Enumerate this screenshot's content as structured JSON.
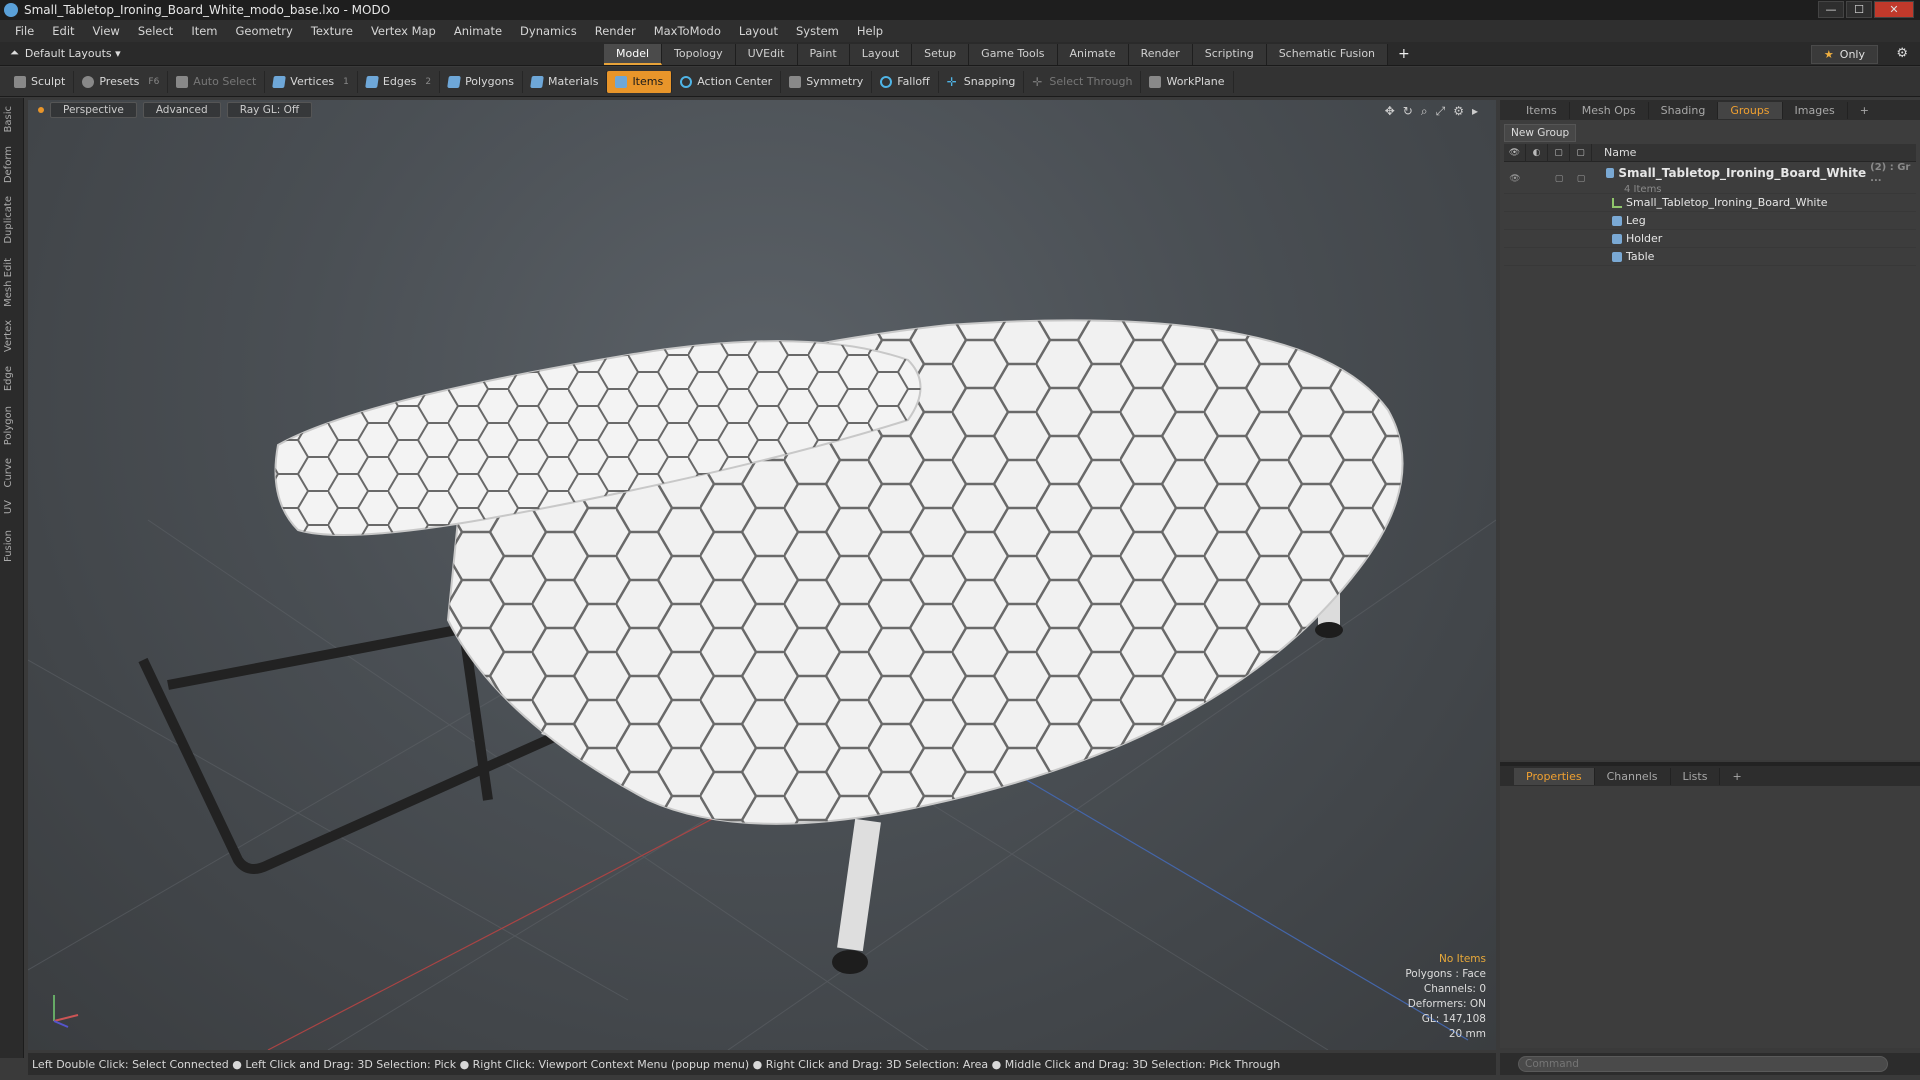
{
  "window": {
    "title": "Small_Tabletop_Ironing_Board_White_modo_base.lxo - MODO"
  },
  "menu": [
    "File",
    "Edit",
    "View",
    "Select",
    "Item",
    "Geometry",
    "Texture",
    "Vertex Map",
    "Animate",
    "Dynamics",
    "Render",
    "MaxToModo",
    "Layout",
    "System",
    "Help"
  ],
  "layouts_label": "Default Layouts ▾",
  "tabs": [
    "Model",
    "Topology",
    "UVEdit",
    "Paint",
    "Layout",
    "Setup",
    "Game Tools",
    "Animate",
    "Render",
    "Scripting",
    "Schematic Fusion"
  ],
  "active_tab": "Model",
  "only_label": "Only",
  "toolbar": {
    "sculpt": "Sculpt",
    "presets": "Presets",
    "presets_key": "F6",
    "auto_select": "Auto Select",
    "vertices": "Vertices",
    "vertices_key": "1",
    "edges": "Edges",
    "edges_key": "2",
    "polygons": "Polygons",
    "materials": "Materials",
    "items": "Items",
    "action_center": "Action Center",
    "symmetry": "Symmetry",
    "falloff": "Falloff",
    "snapping": "Snapping",
    "select_through": "Select Through",
    "workplane": "WorkPlane"
  },
  "left_tabs": [
    "Basic",
    "Deform",
    "Duplicate",
    "Mesh Edit",
    "Vertex",
    "Edge",
    "Polygon",
    "Curve",
    "UV",
    "Fusion"
  ],
  "viewport": {
    "view": "Perspective",
    "shading": "Advanced",
    "raygl": "Ray GL: Off",
    "info": {
      "items": "No Items",
      "polygons": "Polygons : Face",
      "channels": "Channels: 0",
      "deformers": "Deformers: ON",
      "gl": "GL: 147,108",
      "scale": "20 mm"
    }
  },
  "status": "Left Double Click: Select Connected ● Left Click and Drag: 3D Selection: Pick ● Right Click: Viewport Context Menu (popup menu) ● Right Click and Drag: 3D Selection: Area ● Middle Click and Drag: 3D Selection: Pick Through",
  "panel": {
    "tabs": [
      "Items",
      "Mesh Ops",
      "Shading",
      "Groups",
      "Images"
    ],
    "active_tab": "Groups",
    "new_group": "New Group",
    "name_header": "Name",
    "group_name": "Small_Tabletop_Ironing_Board_White",
    "group_suffix": "(2) : Gr ...",
    "group_count": "4 Items",
    "children": [
      "Small_Tabletop_Ironing_Board_White",
      "Leg",
      "Holder",
      "Table"
    ]
  },
  "bottom_tabs": [
    "Properties",
    "Channels",
    "Lists"
  ],
  "command_placeholder": "Command",
  "colors": {
    "accent": "#e8952a",
    "viewport_bg": "#4e5459"
  }
}
